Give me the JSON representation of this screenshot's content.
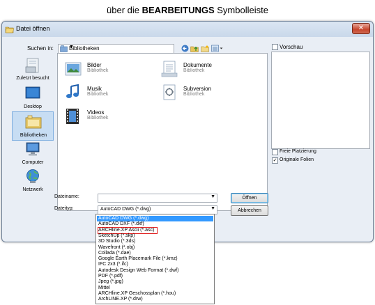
{
  "caption": {
    "pre": "über die ",
    "bold": "BEARBEITUNGS",
    "post": " Symbolleiste"
  },
  "window": {
    "title": "Datei öffnen",
    "close_glyph": "✕"
  },
  "lookin": {
    "label": "Suchen in:",
    "value": "Bibliotheken"
  },
  "places": [
    {
      "label": "Zuletzt besucht"
    },
    {
      "label": "Desktop"
    },
    {
      "label": "Bibliotheken",
      "selected": true
    },
    {
      "label": "Computer"
    },
    {
      "label": "Netzwerk"
    }
  ],
  "files": [
    {
      "name": "Bilder",
      "sub": "Bibliothek"
    },
    {
      "name": "Dokumente",
      "sub": "Bibliothek"
    },
    {
      "name": "Musik",
      "sub": "Bibliothek"
    },
    {
      "name": "Subversion",
      "sub": "Bibliothek"
    },
    {
      "name": "Videos",
      "sub": "Bibliothek"
    }
  ],
  "options": {
    "preview": "Vorschau",
    "free_placement": "Freie Platzierung",
    "original_layers": "Originale Folien",
    "original_layers_checked": true,
    "preview_checked": false,
    "free_placement_checked": false
  },
  "filename": {
    "label": "Dateiname:",
    "value": ""
  },
  "filetype": {
    "label": "Dateityp:",
    "value": "AutoCAD DWG (*.dwg)"
  },
  "buttons": {
    "open": "Öffnen",
    "cancel": "Abbrechen"
  },
  "filetype_options": [
    "AutoCAD DWG (*.dwg)",
    "AutoCAD DXF (*.dxf)",
    "ARCHline.XP Ascii (*.asc)",
    "SketchUp (*.skp)",
    "3D Studio (*.3ds)",
    "Wavefront (*.obj)",
    "Collada (*.dae)",
    "Google Earth Placemark File (*.kmz)",
    "IFC 2x3 (*.ifc)",
    "Autodesk Design Web Format (*.dwf)",
    "PDF (*.pdf)",
    "Jpeg (*.jpg)",
    "Mittel",
    "ARCHline.XP Geschossplan (*.hou)",
    "ArchLINE.XP (*.drw)"
  ],
  "highlight_color": "#3399ff",
  "marker_color": "#e01b1b"
}
